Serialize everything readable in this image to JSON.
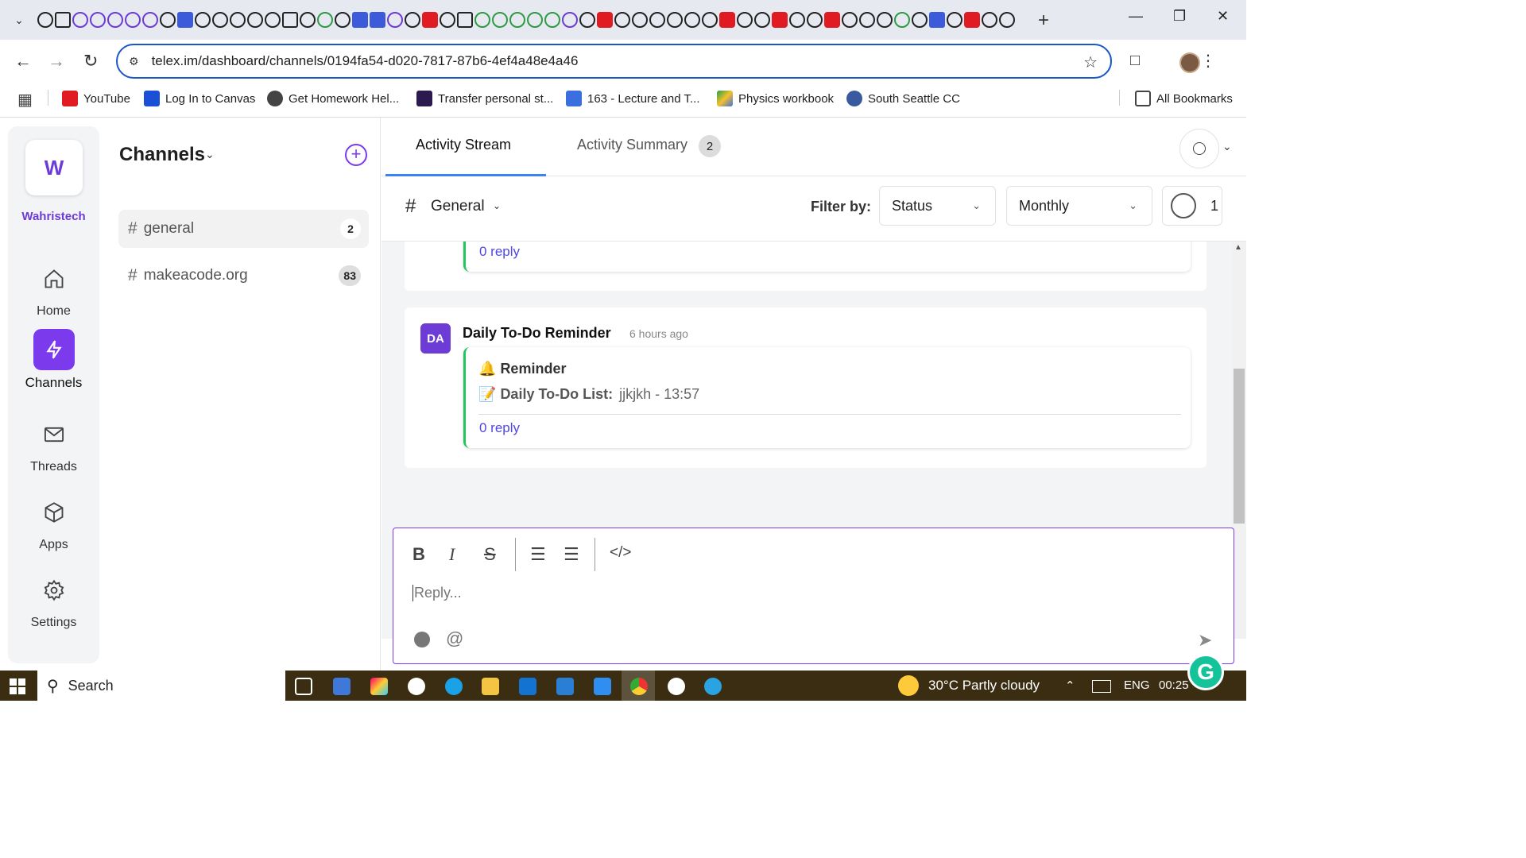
{
  "browser": {
    "url": "telex.im/dashboard/channels/0194fa54-d020-7817-87b6-4ef4a48e4a46",
    "bookmarks": [
      {
        "label": "YouTube",
        "color": "#e01b22"
      },
      {
        "label": "Log In to Canvas",
        "color": "#1a4fd6"
      },
      {
        "label": "Get Homework Hel...",
        "color": "#444444"
      },
      {
        "label": "Transfer personal st...",
        "color": "#2b1a4d"
      },
      {
        "label": "163 - Lecture and T...",
        "color": "#3b6fe0"
      },
      {
        "label": "Physics workbook",
        "color": "#22a04b"
      },
      {
        "label": "South Seattle CC",
        "color": "#3a5aa0"
      }
    ],
    "all_bookmarks": "All Bookmarks"
  },
  "workspace": {
    "initial": "W",
    "name": "Wahristech",
    "accent": "#7c3aed"
  },
  "rail": {
    "home": "Home",
    "channels": "Channels",
    "threads": "Threads",
    "apps": "Apps",
    "settings": "Settings"
  },
  "channels_panel": {
    "title": "Channels",
    "items": [
      {
        "name": "general",
        "count": "2"
      },
      {
        "name": "makeacode.org",
        "count": "83"
      }
    ]
  },
  "tabs": {
    "stream": "Activity Stream",
    "summary": "Activity Summary",
    "summary_count": "2"
  },
  "filter": {
    "channel": "General",
    "label": "Filter by:",
    "status": "Status",
    "period": "Monthly",
    "members": "1"
  },
  "messages": {
    "prev_reply": "0 reply",
    "item": {
      "avatar": "DA",
      "author": "Daily To-Do Reminder",
      "time": "6 hours ago",
      "title": "Reminder",
      "list_label": "Daily To-Do List:",
      "list_value": "jjkjkh - 13:57",
      "reply": "0 reply"
    }
  },
  "composer": {
    "placeholder": "Reply..."
  },
  "taskbar": {
    "search": "Search",
    "weather": "30°C  Partly cloudy",
    "lang": "ENG",
    "time": "00:25"
  }
}
